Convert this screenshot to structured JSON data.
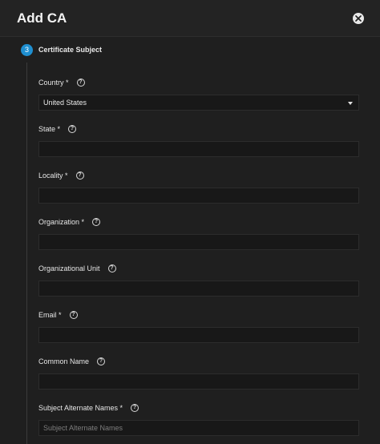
{
  "dialog": {
    "title": "Add CA",
    "close_icon": "close-icon"
  },
  "step": {
    "number": "3",
    "title": "Certificate Subject"
  },
  "fields": [
    {
      "label": "Country *",
      "value": "United States",
      "type": "select"
    },
    {
      "label": "State *",
      "value": ""
    },
    {
      "label": "Locality *",
      "value": ""
    },
    {
      "label": "Organization *",
      "value": ""
    },
    {
      "label": "Organizational Unit",
      "value": ""
    },
    {
      "label": "Email *",
      "value": ""
    },
    {
      "label": "Common Name",
      "value": ""
    },
    {
      "label": "Subject Alternate Names *",
      "value": "",
      "placeholder": "Subject Alternate Names"
    }
  ],
  "help_icon_glyph": "?",
  "colors": {
    "accent": "#1f8fd0",
    "background": "#1f1f1f",
    "input_bg": "#181818"
  }
}
